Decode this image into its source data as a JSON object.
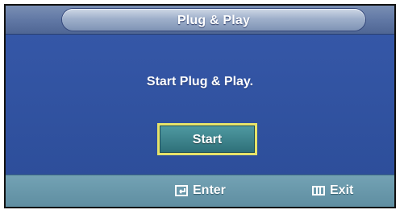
{
  "window": {
    "title": "Plug & Play"
  },
  "content": {
    "prompt": "Start Plug & Play.",
    "start_button_label": "Start"
  },
  "footer": {
    "enter_label": "Enter",
    "enter_icon": "enter-icon",
    "exit_label": "Exit",
    "exit_icon": "exit-icon"
  },
  "colors": {
    "panel_background": "#2e4f9a",
    "button_fill": "#3f8790",
    "button_border": "#e6e36a",
    "footer_background": "#6a98aa"
  }
}
